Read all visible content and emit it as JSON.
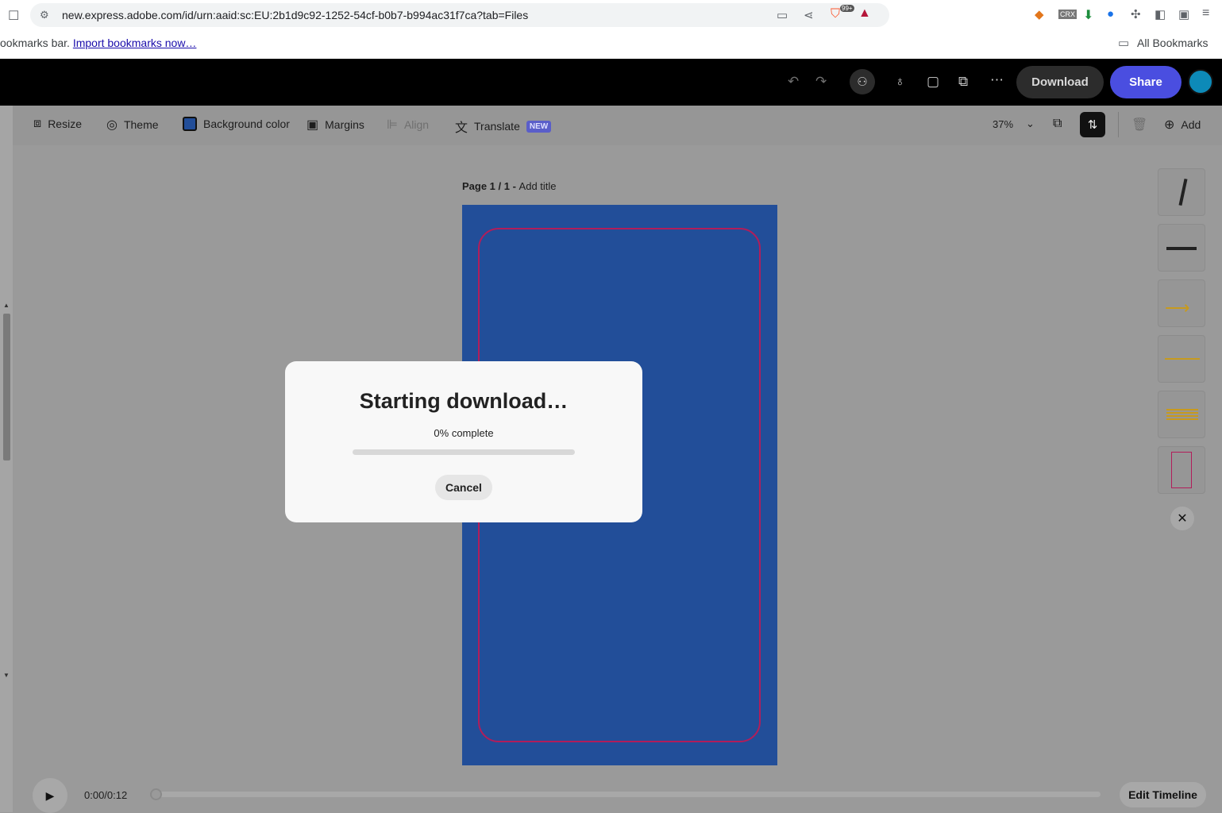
{
  "browser": {
    "url": "new.express.adobe.com/id/urn:aaid:sc:EU:2b1d9c92-1252-54cf-b0b7-b994ac31f7ca?tab=Files",
    "bookmarks_bar_text": "ookmarks bar.",
    "bookmarks_link": "Import bookmarks now…",
    "all_bookmarks": "All Bookmarks",
    "extension_badge": "99+"
  },
  "header": {
    "download_label": "Download",
    "share_label": "Share"
  },
  "toolbar": {
    "resize": "Resize",
    "theme": "Theme",
    "background_color": "Background color",
    "margins": "Margins",
    "align": "Align",
    "translate": "Translate",
    "new_badge": "NEW",
    "zoom": "37%",
    "add": "Add"
  },
  "canvas": {
    "page_label": "Page 1 / 1 - ",
    "page_title_placeholder": "Add title",
    "artboard_color": "#224e99",
    "frame_color": "#b21d5a"
  },
  "timeline": {
    "time": "0:00/0:12",
    "edit_label": "Edit Timeline"
  },
  "dialog": {
    "title": "Starting download…",
    "progress_text": "0% complete",
    "progress_percent": 0,
    "cancel_label": "Cancel"
  },
  "colors": {
    "accent": "#4a4ee0",
    "header_bg": "#000000"
  }
}
